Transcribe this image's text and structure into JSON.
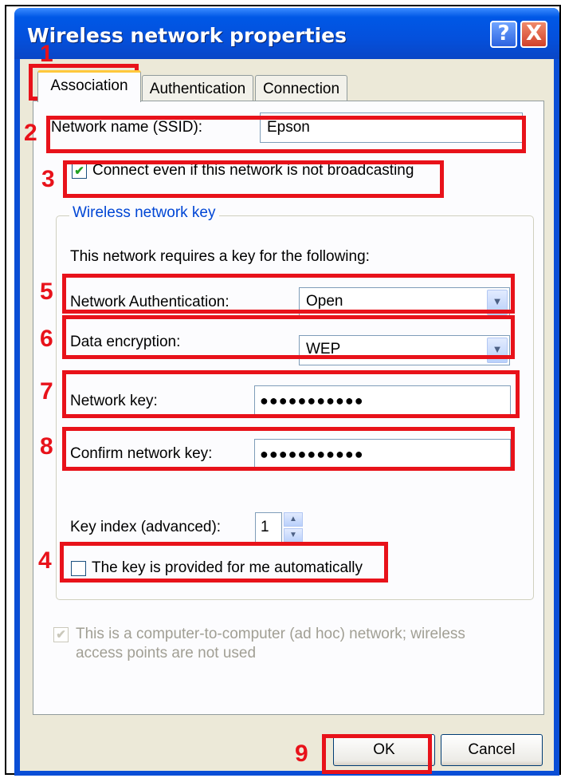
{
  "window": {
    "title": "Wireless network properties",
    "help_glyph": "?",
    "close_glyph": "X"
  },
  "tabs": [
    {
      "label": "Association",
      "active": true
    },
    {
      "label": "Authentication",
      "active": false
    },
    {
      "label": "Connection",
      "active": false
    }
  ],
  "form": {
    "ssid_label": "Network name (SSID):",
    "ssid_value": "Epson",
    "broadcast_checkbox_label": "Connect even if this network is not broadcasting",
    "broadcast_checked": true,
    "group_title": "Wireless network key",
    "requires_key_text": "This network requires a key for the following:",
    "auth_label": "Network Authentication:",
    "auth_value": "Open",
    "encryption_label": "Data encryption:",
    "encryption_value": "WEP",
    "network_key_label": "Network key:",
    "network_key_value": "●●●●●●●●●●●",
    "confirm_key_label": "Confirm network key:",
    "confirm_key_value": "●●●●●●●●●●●",
    "key_index_label": "Key index (advanced):",
    "key_index_value": "1",
    "auto_key_label": "The key is provided for me automatically",
    "auto_key_checked": false,
    "adhoc_label_line1": "This is a computer-to-computer (ad hoc) network; wireless",
    "adhoc_label_line2": "access points are not used",
    "adhoc_checked": true
  },
  "buttons": {
    "ok": "OK",
    "cancel": "Cancel"
  },
  "annotations": {
    "color": "#e8121a",
    "markers": [
      "1",
      "2",
      "3",
      "4",
      "5",
      "6",
      "7",
      "8",
      "9"
    ]
  }
}
